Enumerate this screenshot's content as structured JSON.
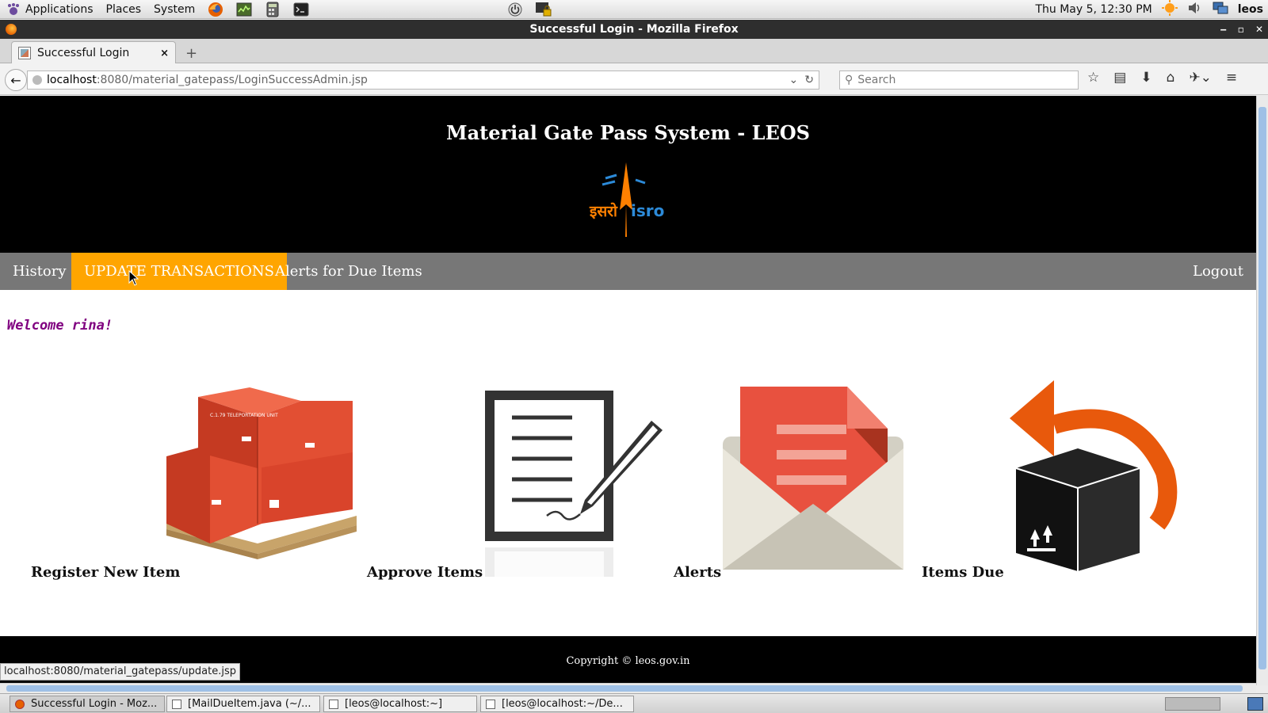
{
  "os_panel": {
    "menus": [
      "Applications",
      "Places",
      "System"
    ],
    "launchers": [
      "firefox-icon",
      "system-monitor-icon",
      "calculator-icon",
      "terminal-icon"
    ],
    "clock": "Thu May  5, 12:30 PM",
    "user": "leos"
  },
  "window": {
    "title": "Successful Login - Mozilla Firefox"
  },
  "browser": {
    "tab_title": "Successful Login",
    "url_host": "localhost",
    "url_rest": ":8080/material_gatepass/LoginSuccessAdmin.jsp",
    "search_placeholder": "Search",
    "status_url": "localhost:8080/material_gatepass/update.jsp"
  },
  "page": {
    "site_title": "Material Gate Pass System - LEOS",
    "logo_text_left": "इसरो",
    "logo_text_right": "isro",
    "menu": {
      "history": "History",
      "update_transactions": "UPDATE TRANSACTIONS",
      "alerts_due": "Alerts for Due Items",
      "logout": "Logout"
    },
    "welcome": "Welcome rina!",
    "features": {
      "register": "Register New Item",
      "approve": "Approve Items",
      "alerts": "Alerts",
      "items_due": "Items Due"
    },
    "box_label": "C.1.79 TELEPORTATION UNIT",
    "footer": "Copyright © leos.gov.in",
    "colors": {
      "header_bg": "#000000",
      "menu_bg": "#777777",
      "menu_active": "#ffa500",
      "welcome": "#800080",
      "box_red": "#d9442b",
      "envelope_red": "#e8513f",
      "arrow_orange": "#e8590c"
    }
  },
  "taskbar": {
    "items": [
      "Successful Login - Moz...",
      "[MailDueItem.java (~/...",
      "[leos@localhost:~]",
      "[leos@localhost:~/De..."
    ]
  }
}
